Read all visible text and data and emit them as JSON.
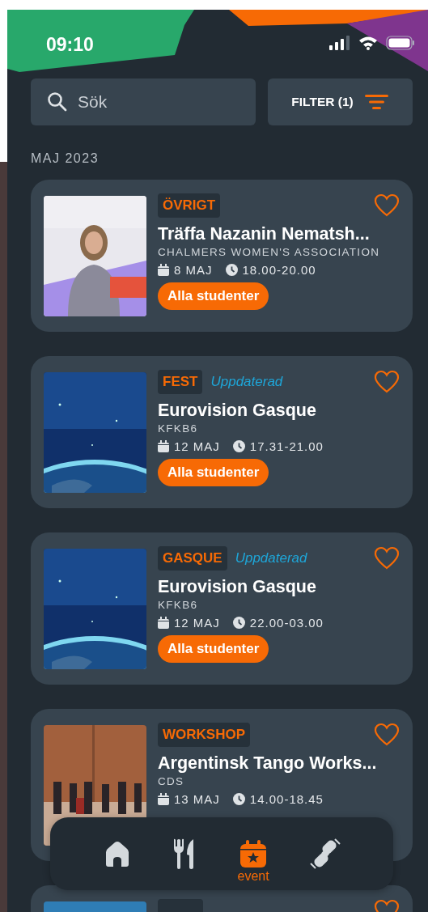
{
  "status_bar": {
    "time": "09:10"
  },
  "search": {
    "placeholder": "Sök"
  },
  "filter_button": {
    "label": "FILTER (1)"
  },
  "section_heading": "MAJ 2023",
  "events": [
    {
      "category": "ÖVRIGT",
      "title": "Träffa Nazanin Nematsh...",
      "organizer": "CHALMERS WOMEN'S ASSOCIATION",
      "date": "8 MAJ",
      "time": "18.00-20.00",
      "audience": "Alla studenter",
      "favorite": false
    },
    {
      "category": "FEST",
      "status": "Uppdaterad",
      "title": "Eurovision Gasque",
      "organizer": "KFKB6",
      "date": "12 MAJ",
      "time": "17.31-21.00",
      "audience": "Alla studenter",
      "favorite": false
    },
    {
      "category": "GASQUE",
      "status": "Uppdaterad",
      "title": "Eurovision Gasque",
      "organizer": "KFKB6",
      "date": "12 MAJ",
      "time": "22.00-03.00",
      "audience": "Alla studenter",
      "favorite": false
    },
    {
      "category": "WORKSHOP",
      "title": "Argentinsk Tango Works...",
      "organizer": "CDS",
      "date": "13 MAJ",
      "time": "14.00-18.45",
      "favorite": false
    },
    {
      "favorite": false
    }
  ],
  "nav": [
    {
      "kind": "home",
      "selected": false
    },
    {
      "kind": "food",
      "selected": false
    },
    {
      "kind": "event",
      "label": "event",
      "selected": true
    },
    {
      "kind": "gym",
      "selected": false
    }
  ]
}
